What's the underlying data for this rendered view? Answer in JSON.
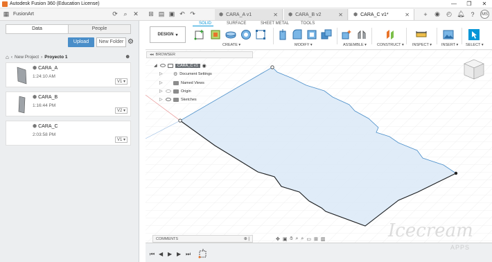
{
  "window": {
    "title": "Autodesk Fusion 360 (Education License)",
    "controls": [
      "—",
      "❐",
      "✕"
    ]
  },
  "tabbar": {
    "project_name": "FusionArt",
    "tabs": [
      {
        "label": "CARA_A v1",
        "active": false
      },
      {
        "label": "CARA_B v2",
        "active": false
      },
      {
        "label": "CARA_C v1*",
        "active": true
      }
    ],
    "user_initials": "MS"
  },
  "data_panel": {
    "tabs": {
      "data": "Data",
      "people": "People"
    },
    "upload_label": "Upload",
    "new_folder_label": "New Folder",
    "breadcrumb": {
      "parent": "New Project",
      "current": "Proyecto 1"
    },
    "files": [
      {
        "name": "CARA_A",
        "time": "1:24:10 AM",
        "version": "V1"
      },
      {
        "name": "CARA_B",
        "time": "1:16:44 PM",
        "version": "V2"
      },
      {
        "name": "CARA_C",
        "time": "2:03:58 PM",
        "version": "V1"
      }
    ]
  },
  "toolbar": {
    "design_label": "DESIGN",
    "workspace_tabs": [
      "SOLID",
      "SURFACE",
      "SHEET METAL",
      "TOOLS"
    ],
    "active_tab": "SOLID",
    "groups": [
      "CREATE",
      "MODIFY",
      "ASSEMBLE",
      "CONSTRUCT",
      "INSPECT",
      "INSERT",
      "SELECT"
    ]
  },
  "browser": {
    "header": "BROWSER",
    "component": "CARA_C v1",
    "items": [
      "Document Settings",
      "Named Views",
      "Origin",
      "Sketches"
    ]
  },
  "comments_label": "COMMENTS",
  "watermark": {
    "text": "Icecream",
    "sub": "APPS"
  },
  "colors": {
    "accent": "#0696d7",
    "upload": "#4a8ec9",
    "sketch_fill": "#dbe9f7",
    "grid": "#e6e6e6"
  }
}
